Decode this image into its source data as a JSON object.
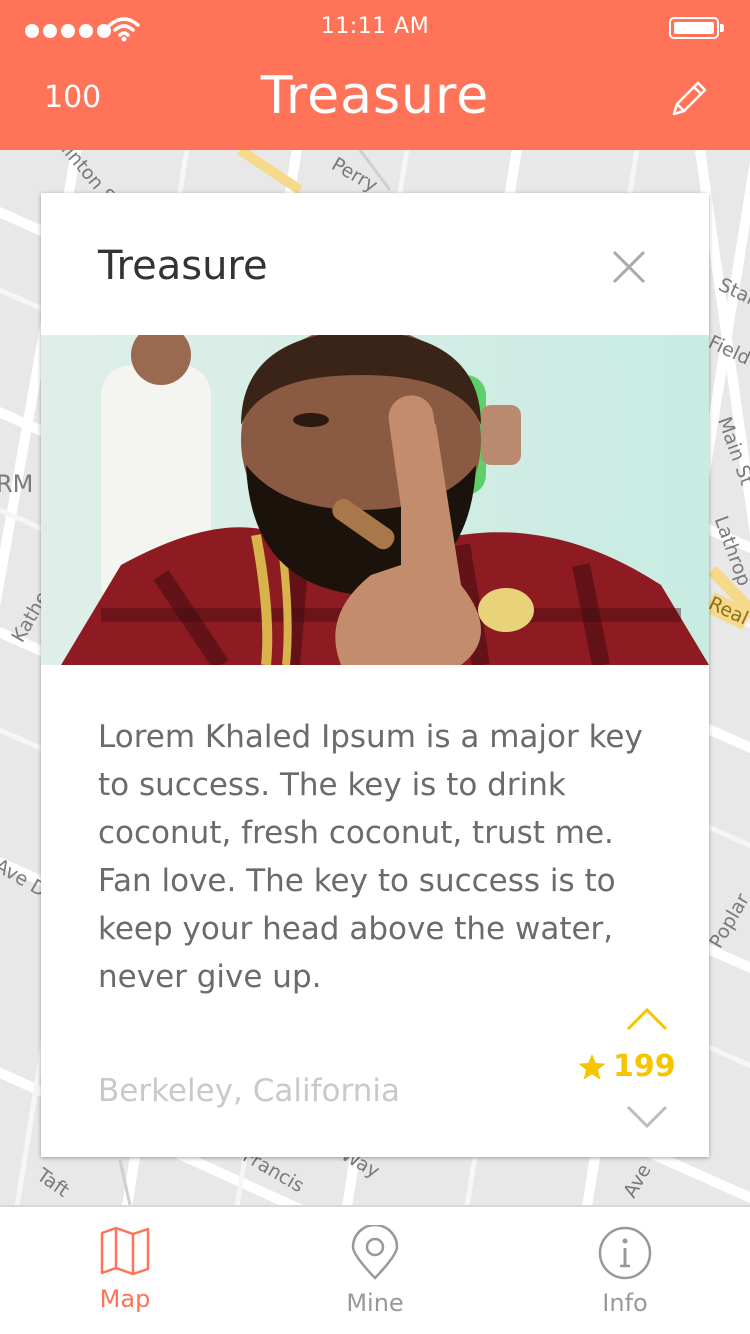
{
  "status_bar": {
    "time": "11:11 AM"
  },
  "header": {
    "score": "100",
    "title": "Treasure"
  },
  "map_labels": [
    "Clinton St",
    "Perry",
    "Stanford",
    "Field Rd",
    "Main St",
    "Lathrop",
    "Real",
    "RM",
    "Katherine",
    "Ave De",
    "Poplar",
    "Taft",
    "Francis",
    "Way",
    "Ave"
  ],
  "card": {
    "title": "Treasure",
    "body": "Lorem Khaled Ipsum is a major key to success. The key is to drink coconut, fresh coconut, trust me. Fan love. The key to success is to keep your head above the water, never give up.",
    "location": "Berkeley, California",
    "votes": "199"
  },
  "tabs": [
    {
      "label": "Map",
      "icon": "map-icon",
      "active": true
    },
    {
      "label": "Mine",
      "icon": "location-pin-icon",
      "active": false
    },
    {
      "label": "Info",
      "icon": "info-icon",
      "active": false
    }
  ],
  "colors": {
    "accent": "#ff7358",
    "star": "#f7c400"
  }
}
